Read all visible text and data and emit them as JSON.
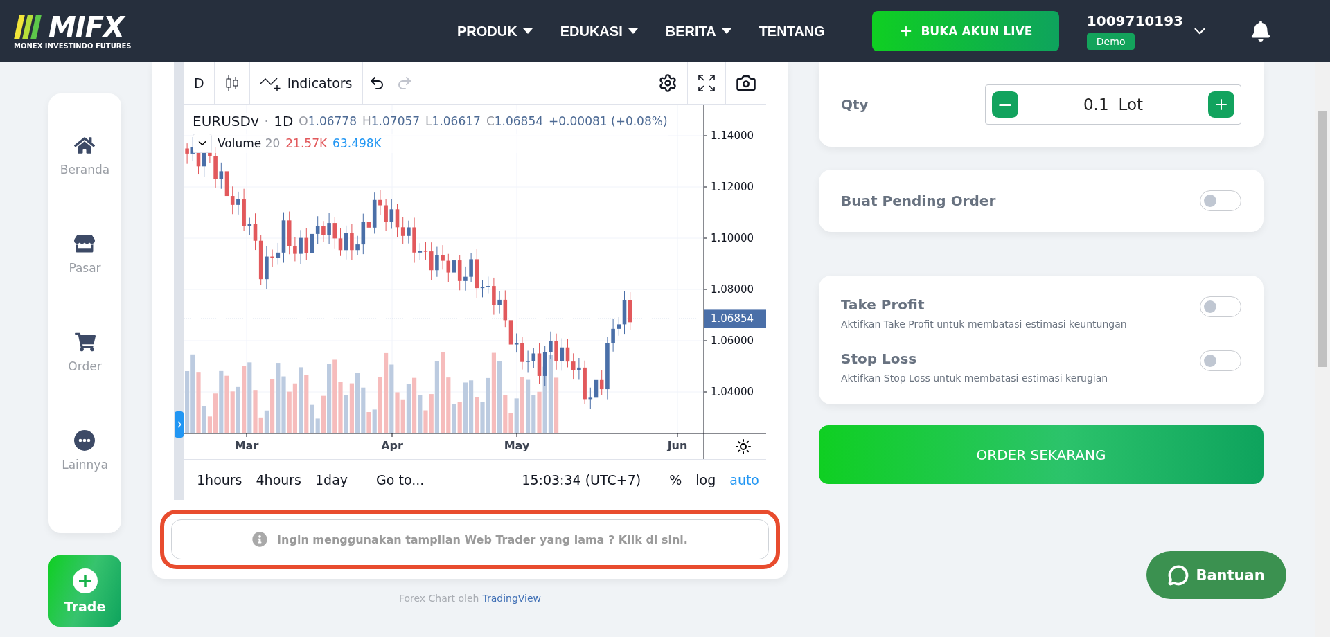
{
  "header": {
    "logo": {
      "mark": "MIFX",
      "tagline": "MONEX INVESTINDO FUTURES"
    },
    "nav": [
      {
        "label": "PRODUK",
        "dropdown": true
      },
      {
        "label": "EDUKASI",
        "dropdown": true
      },
      {
        "label": "BERITA",
        "dropdown": true
      },
      {
        "label": "TENTANG",
        "dropdown": false
      }
    ],
    "cta": "BUKA AKUN LIVE",
    "account": {
      "number": "1009710193",
      "badge": "Demo"
    }
  },
  "sidebar": {
    "items": [
      {
        "label": "Beranda",
        "kind": "home"
      },
      {
        "label": "Pasar",
        "kind": "store"
      },
      {
        "label": "Order",
        "kind": "cart"
      },
      {
        "label": "Lainnya",
        "kind": "more"
      }
    ],
    "trade_button": "Trade"
  },
  "chart": {
    "toolbar": {
      "interval": "D",
      "indicators": "Indicators"
    },
    "legend": {
      "symbol": "EURUSDv",
      "separator": "·",
      "interval": "1D",
      "ohlc": [
        {
          "key": "O",
          "value": "1.06778"
        },
        {
          "key": "H",
          "value": "1.07057"
        },
        {
          "key": "L",
          "value": "1.06617"
        },
        {
          "key": "C",
          "value": "1.06854"
        }
      ],
      "change": "+0.00081 (+0.08%)"
    },
    "volume": {
      "label": "Volume",
      "length": "20",
      "value_1": "21.57K",
      "value_2": "63.498K"
    },
    "price_axis": [
      "1.14000",
      "1.12000",
      "1.10000",
      "1.08000",
      "1.06000",
      "1.04000"
    ],
    "last_price": "1.06854",
    "time_axis": [
      "Mar",
      "Apr",
      "May",
      "Jun"
    ],
    "bottom_bar": {
      "ranges": [
        "1hours",
        "4hours",
        "1day"
      ],
      "goto": "Go to...",
      "clock": "15:03:34 (UTC+7)",
      "scale_options": [
        {
          "label": "%",
          "selected": false
        },
        {
          "label": "log",
          "selected": false
        },
        {
          "label": "auto",
          "selected": true
        }
      ]
    }
  },
  "notice": "Ingin menggunakan tampilan Web Trader yang lama ? Klik di sini.",
  "credit": {
    "text": "Forex Chart oleh",
    "link": "TradingView"
  },
  "order_panel": {
    "qty": {
      "label": "Qty",
      "value": "0.1",
      "unit": "Lot"
    },
    "pending": {
      "label": "Buat Pending Order",
      "on": false
    },
    "options": [
      {
        "title": "Take Profit",
        "description": "Aktifkan Take Profit untuk membatasi estimasi keuntungan",
        "on": false
      },
      {
        "title": "Stop Loss",
        "description": "Aktifkan Stop Loss untuk membatasi estimasi kerugian",
        "on": false
      }
    ],
    "submit": "ORDER SEKARANG"
  },
  "help_button": "Bantuan"
}
